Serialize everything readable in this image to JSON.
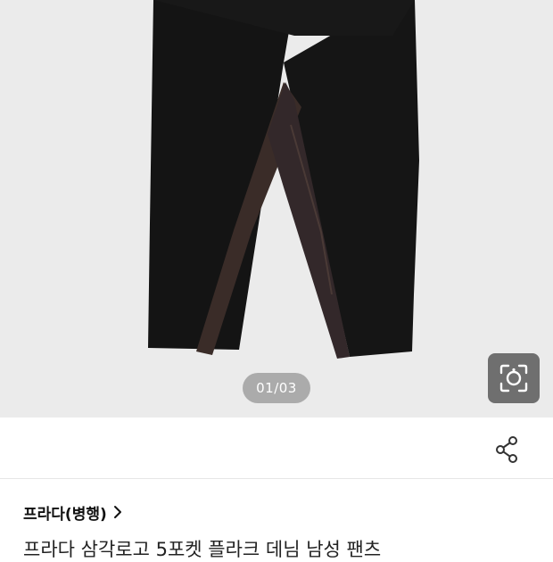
{
  "gallery": {
    "page_indicator": "01/03",
    "image_subject": "black pants with dark brown satin side panels"
  },
  "icons": {
    "lens": "camera-lens-icon",
    "share": "share-icon",
    "chevron": "chevron-right-icon"
  },
  "product": {
    "brand": "프라다(병행)",
    "title": "프라다 삼각로고 5포켓 플라크 데님 남성 팬츠"
  },
  "colors": {
    "hero_background": "#ebebeb",
    "pants": "#141414",
    "side_panel": "#3a2c28",
    "indicator": "#a0a0a0",
    "lens_button": "#6f6f6f"
  }
}
